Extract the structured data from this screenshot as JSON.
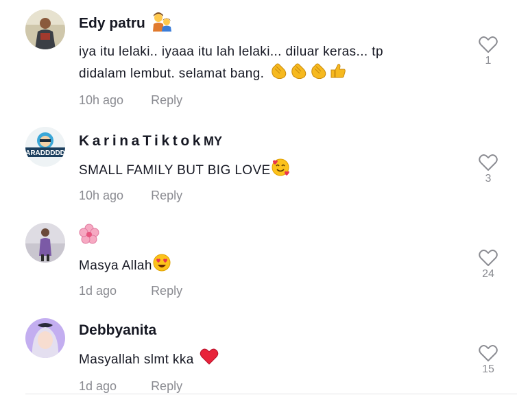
{
  "comments": [
    {
      "username": "Edy patru",
      "text_line1": "iya itu lelaki.. iyaaa itu lah lelaki... diluar keras... tp",
      "text_line2": "didalam lembut. selamat bang.",
      "time": "10h ago",
      "reply": "Reply",
      "likes": "1"
    },
    {
      "username": "KarinaTiktok",
      "username_suffix": "MY",
      "avatar_text": "ARADDDDD",
      "text": "SMALL FAMILY BUT BIG LOVE",
      "time": "10h ago",
      "reply": "Reply",
      "likes": "3"
    },
    {
      "username": "",
      "text": "Masya Allah",
      "time": "1d ago",
      "reply": "Reply",
      "likes": "24"
    },
    {
      "username": "Debbyanita",
      "text": "Masyallah slmt kka",
      "time": "1d ago",
      "reply": "Reply",
      "likes": "15"
    }
  ],
  "icons": {
    "like": "heart-outline-icon",
    "clap": "clapping-hands-emoji",
    "thumbs": "thumbs-up-emoji",
    "family": "family-emoji",
    "smiling_hearts": "smiling-face-with-hearts-emoji",
    "heart_eyes": "heart-eyes-emoji",
    "red_heart": "red-heart-emoji",
    "blossom": "cherry-blossom-emoji"
  }
}
